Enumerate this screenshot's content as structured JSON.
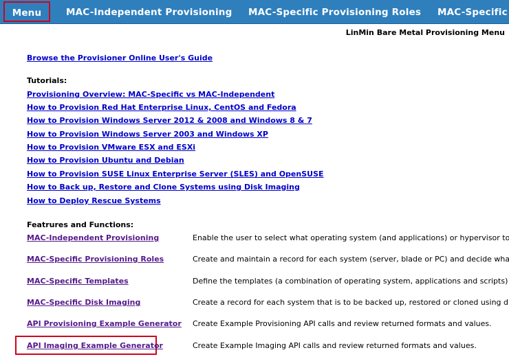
{
  "nav": {
    "tabs": [
      "Menu",
      "MAC-Independent Provisioning",
      "MAC-Specific Provisioning Roles",
      "MAC-Specific Te"
    ]
  },
  "page_title": "LinMin Bare Metal Provisioning Menu",
  "guide_link": "Browse the Provisioner Online User's Guide",
  "tutorials": {
    "heading": "Tutorials:",
    "links": [
      "Provisioning Overview: MAC-Specific vs MAC-Independent",
      "How to Provision Red Hat Enterprise Linux, CentOS and Fedora",
      "How to Provision Windows Server 2012 & 2008 and Windows 8 & 7",
      "How to Provision Windows Server 2003 and Windows XP",
      "How to Provision VMware ESX and ESXi",
      "How to Provision Ubuntu and Debian",
      "How to Provision SUSE Linux Enterprise Server (SLES) and OpenSUSE",
      "How to Back up, Restore and Clone Systems using Disk Imaging",
      "How to Deploy Rescue Systems"
    ]
  },
  "features": {
    "heading": "Featrures and Functions:",
    "items": [
      {
        "label": "MAC-Independent Provisioning",
        "desc": "Enable the user to select what operating system (and applications) or hypervisor to insta"
      },
      {
        "label": "MAC-Specific Provisioning Roles",
        "desc": "Create and maintain a record for each system (server, blade or PC) and decide what o"
      },
      {
        "label": "MAC-Specific Templates",
        "desc": "Define the templates (a combination of operating system, applications and scripts) that"
      },
      {
        "label": "MAC-Specific Disk Imaging",
        "desc": "Create a record for each system that is to be backed up, restored or cloned using disk i"
      },
      {
        "label": "API Provisioning Example Generator",
        "desc": "Create Example Provisioning API calls and review returned formats and values."
      },
      {
        "label": "API Imaging Example Generator",
        "desc": "Create Example Imaging API calls and review returned formats and values."
      }
    ]
  }
}
